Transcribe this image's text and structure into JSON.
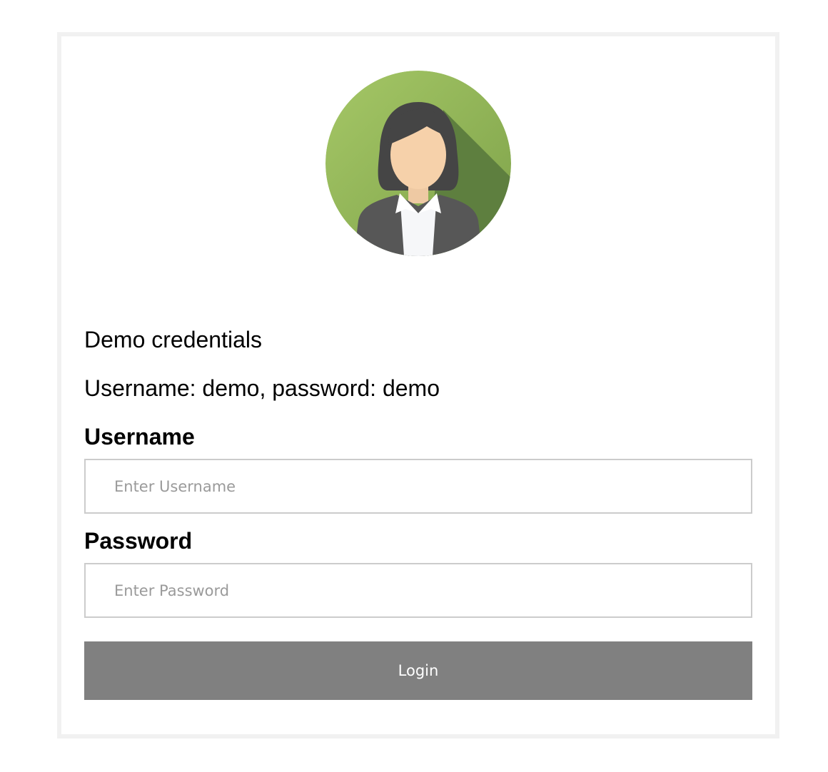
{
  "login": {
    "avatar_icon": "female-user-avatar-icon",
    "demo_title": "Demo credentials",
    "demo_credentials": "Username: demo, password: demo",
    "username_label": "Username",
    "username_placeholder": "Enter Username",
    "username_value": "",
    "password_label": "Password",
    "password_placeholder": "Enter Password",
    "password_value": "",
    "login_button_label": "Login"
  },
  "colors": {
    "avatar_background": "#8fbb59",
    "button_background": "#808080",
    "button_text": "#ffffff",
    "input_border": "#cccccc",
    "card_border": "#f1f1f1"
  }
}
